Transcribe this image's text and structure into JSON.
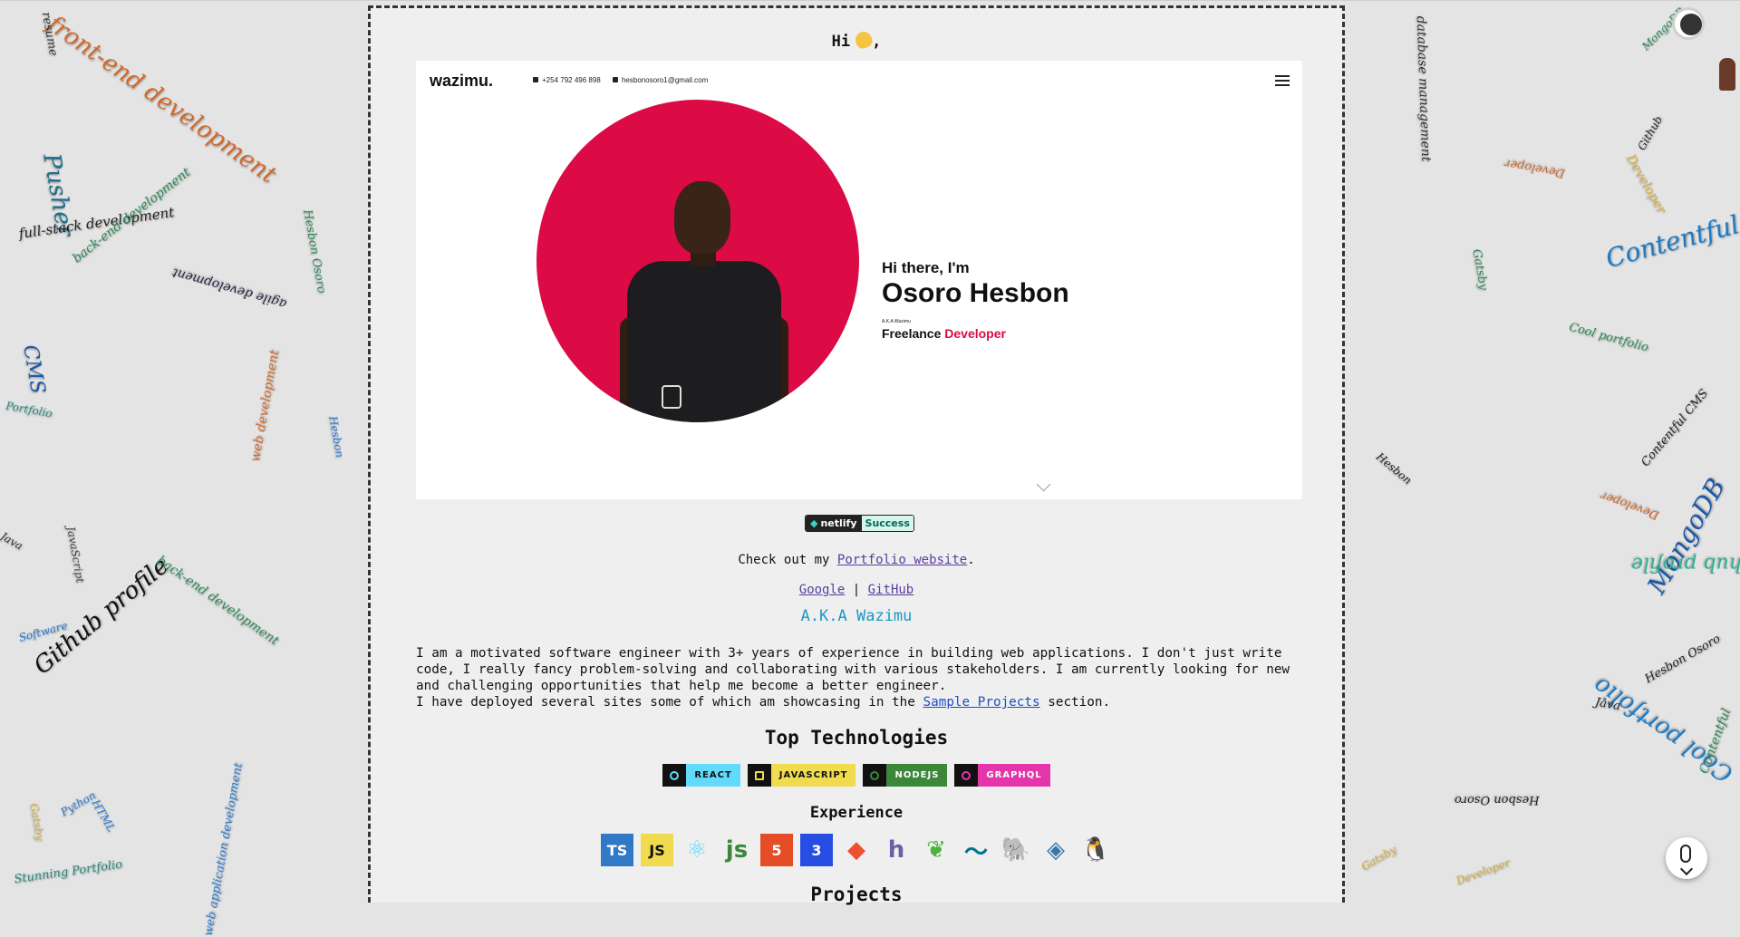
{
  "greeting": "Hi",
  "hero": {
    "logo": "wazimu.",
    "phone": "+254 792 496 898",
    "email": "hesbonosoro1@gmail.com",
    "intro": "Hi there, I'm",
    "name": "Osoro Hesbon",
    "aka_small": "A.K.A Wazimu",
    "role_prefix": "Freelance",
    "role_accent": "Developer"
  },
  "badge": {
    "brand": "netlify",
    "status": "Success"
  },
  "portfolio_line": {
    "prefix": "Check out my",
    "link": "Portfolio website",
    "suffix": "."
  },
  "links": {
    "google": "Google",
    "separator": "|",
    "github": "GitHub"
  },
  "aka": "A.K.A Wazimu",
  "bio": {
    "text": "I am a motivated software engineer with 3+ years of experience in building web applications. I don't just write code, I really fancy problem-solving and collaborating with various stakeholders. I am currently looking for new and challenging opportunities that help me become a better engineer.",
    "line2_prefix": "I have deployed several sites some of which am showcasing in the",
    "line2_link": "Sample Projects",
    "line2_suffix": "section."
  },
  "top_tech": {
    "title": "Top Technologies",
    "badges": [
      {
        "label": "REACT",
        "color": "#61dafb",
        "icon_color": "#61dafb"
      },
      {
        "label": "JAVASCRIPT",
        "color": "#f0db4f",
        "icon_color": "#f0db4f"
      },
      {
        "label": "NODEJS",
        "color": "#3c873a",
        "icon_color": "#3c873a"
      },
      {
        "label": "GRAPHQL",
        "color": "#e535ab",
        "icon_color": "#e535ab"
      }
    ]
  },
  "experience": {
    "title": "Experience",
    "icons": [
      {
        "name": "typescript-icon",
        "text": "TS",
        "bg": "#3178c6",
        "fg": "#ffffff"
      },
      {
        "name": "javascript-icon",
        "text": "JS",
        "bg": "#f0db4f",
        "fg": "#111111"
      },
      {
        "name": "react-icon",
        "text": "⚛",
        "bg": "transparent",
        "fg": "#61dafb"
      },
      {
        "name": "nodejs-icon",
        "text": "js",
        "bg": "transparent",
        "fg": "#3c873a"
      },
      {
        "name": "html5-icon",
        "text": "5",
        "bg": "#e44d26",
        "fg": "#ffffff"
      },
      {
        "name": "css3-icon",
        "text": "3",
        "bg": "#264de4",
        "fg": "#ffffff"
      },
      {
        "name": "git-icon",
        "text": "◆",
        "bg": "transparent",
        "fg": "#f05032"
      },
      {
        "name": "heroku-icon",
        "text": "h",
        "bg": "transparent",
        "fg": "#6762a6"
      },
      {
        "name": "mongodb-icon",
        "text": "❦",
        "bg": "transparent",
        "fg": "#4db33d"
      },
      {
        "name": "mysql-icon",
        "text": "〜",
        "bg": "transparent",
        "fg": "#00758f"
      },
      {
        "name": "postgresql-icon",
        "text": "🐘",
        "bg": "transparent",
        "fg": "#336791"
      },
      {
        "name": "python-icon",
        "text": "◈",
        "bg": "transparent",
        "fg": "#3776ab"
      },
      {
        "name": "linux-icon",
        "text": "🐧",
        "bg": "transparent",
        "fg": "#111111"
      }
    ]
  },
  "projects_title": "Projects",
  "word_cloud": [
    "front-end development",
    "Pusher",
    "full-stack development",
    "back-end development",
    "agile development",
    "CMS",
    "Portfolio",
    "web development",
    "Hesbon",
    "Github profile",
    "Java",
    "JavaScript",
    "Software",
    "MongoDB",
    "Contentful",
    "database management",
    "Developer",
    "Cool portfolio",
    "Contentful CMS",
    "Hesbon Osoro",
    "Gatsby",
    "Python",
    "HTML",
    "Stunning Portfolio",
    "resume",
    "Github",
    "web application development"
  ]
}
